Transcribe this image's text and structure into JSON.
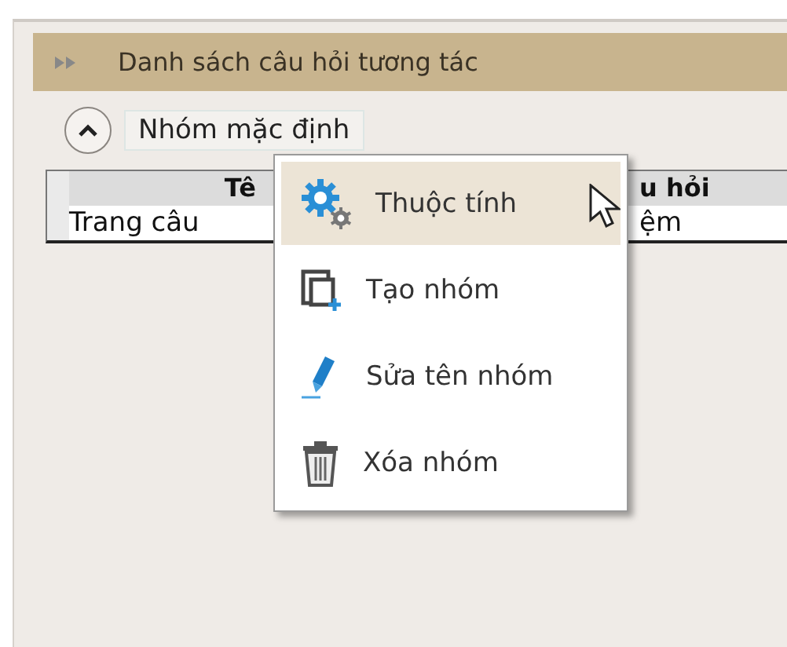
{
  "panel": {
    "title": "Danh sách câu hỏi tương tác"
  },
  "group": {
    "name": "Nhóm mặc định",
    "expanded": true
  },
  "table": {
    "columns": [
      "Tê",
      "u hỏi"
    ],
    "rows": [
      [
        "Trang câu",
        "ệm"
      ]
    ]
  },
  "context_menu": {
    "items": [
      {
        "label": "Thuộc tính",
        "selected": true
      },
      {
        "label": "Tạo nhóm",
        "selected": false
      },
      {
        "label": "Sửa tên nhóm",
        "selected": false
      },
      {
        "label": "Xóa nhóm",
        "selected": false
      }
    ]
  }
}
